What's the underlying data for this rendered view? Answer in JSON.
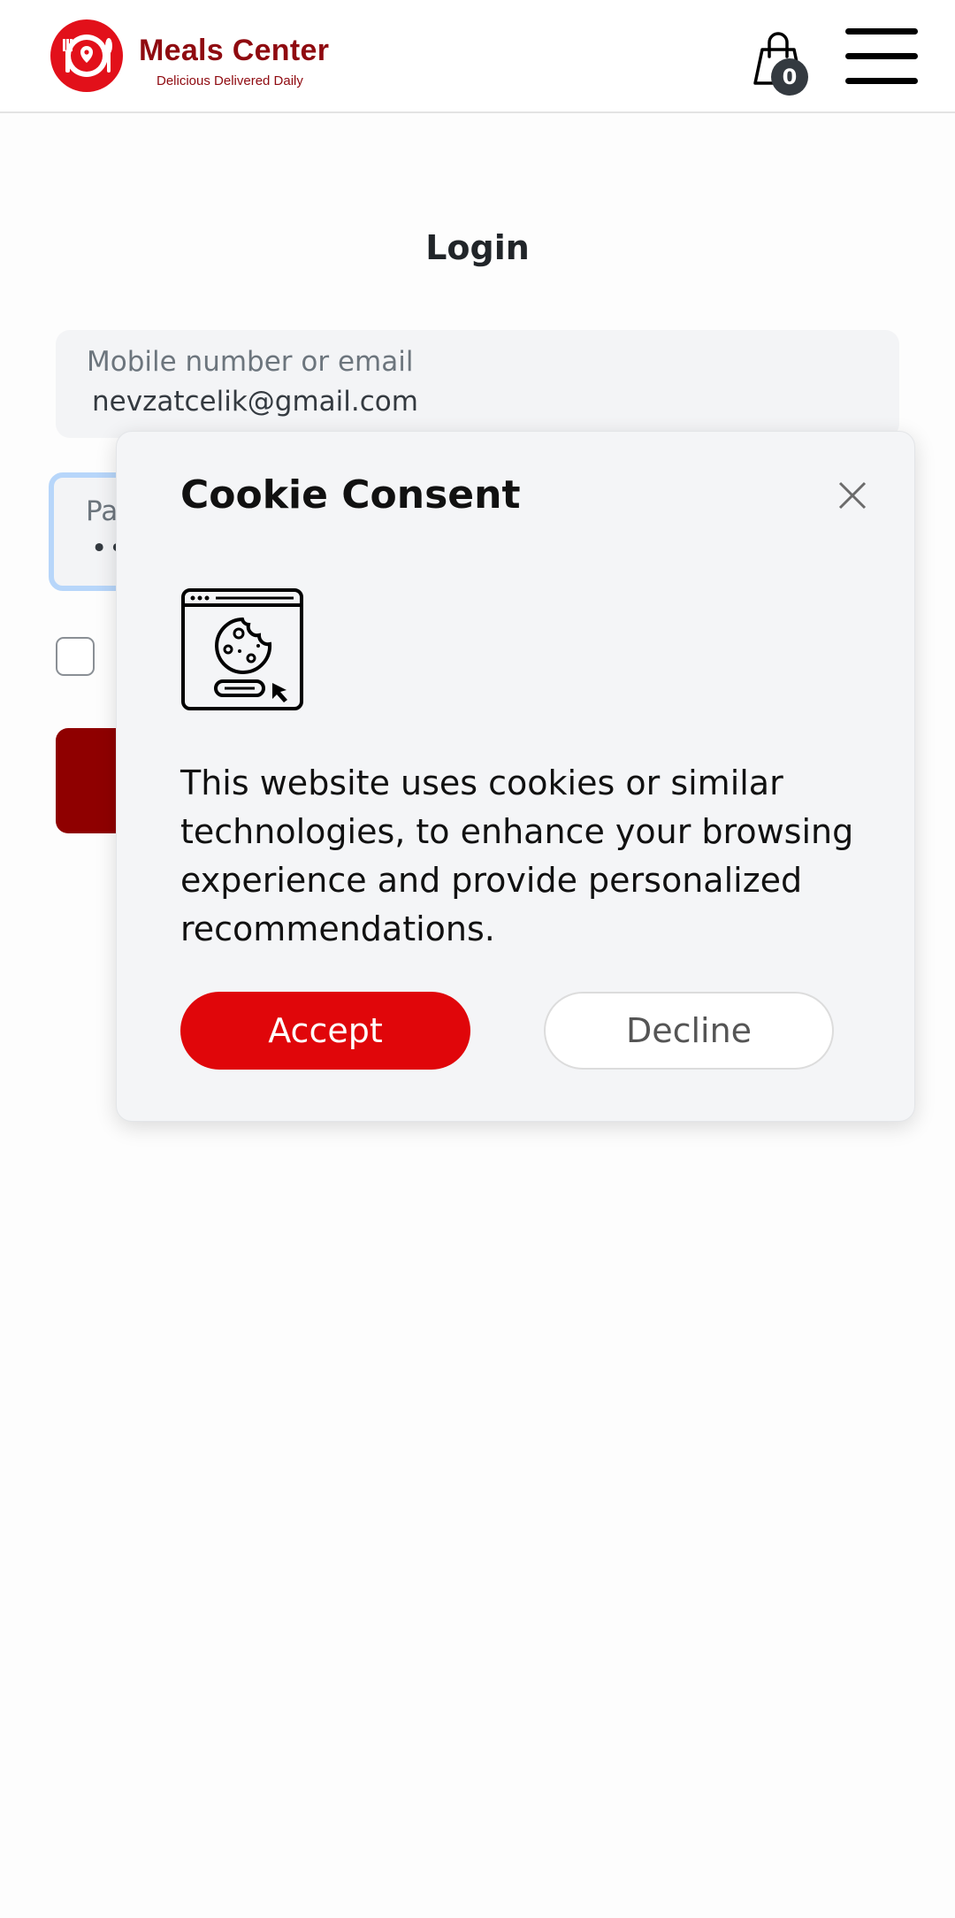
{
  "header": {
    "brand_name": "Meals Center",
    "brand_tagline": "Delicious Delivered Daily",
    "cart_count": "0",
    "brand_color": "#e2101a",
    "icons": [
      "logo-icon",
      "shopping-bag-icon",
      "hamburger-menu-icon"
    ]
  },
  "login": {
    "title": "Login",
    "email_label": "Mobile number or email",
    "email_value": "nevzatcelik@gmail.com",
    "password_label": "Pa",
    "password_value": "••"
  },
  "cookie": {
    "title": "Cookie Consent",
    "text": "This website uses cookies or similar technologies, to enhance your browsing experience and provide personalized recommendations.",
    "accept_label": "Accept",
    "decline_label": "Decline",
    "accept_color": "#e0060a",
    "icons": [
      "close-icon",
      "cookie-browser-icon"
    ]
  }
}
